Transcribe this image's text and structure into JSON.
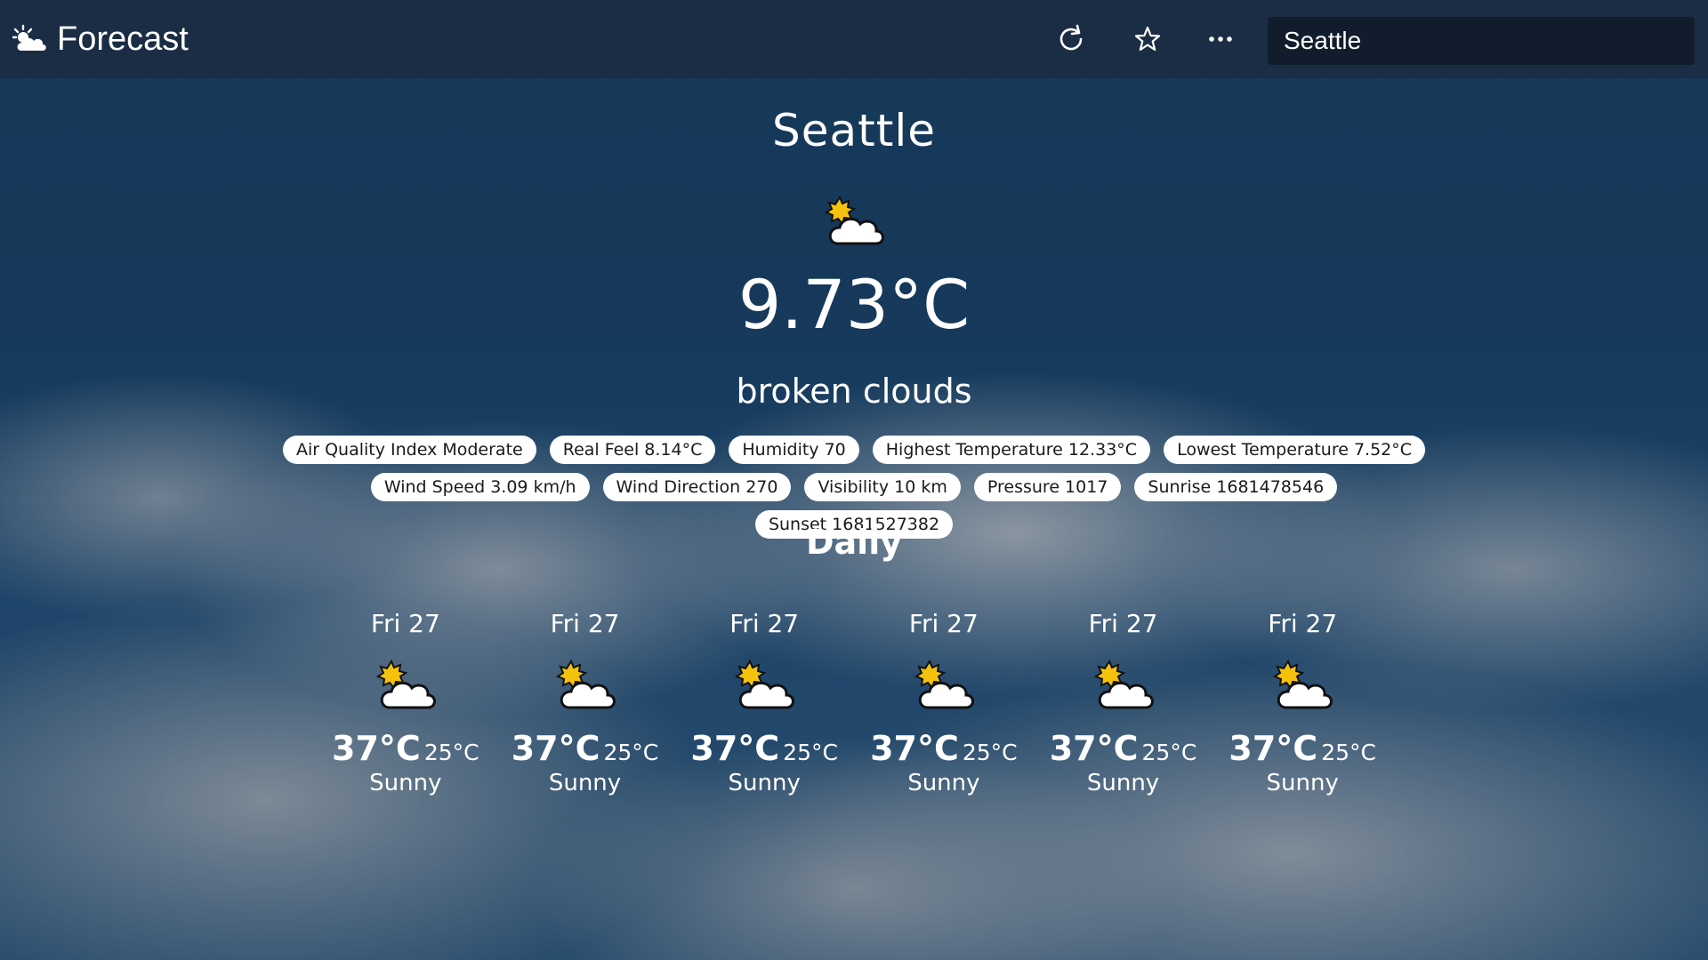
{
  "app": {
    "title": "Forecast",
    "icon": "sun-cloud-icon"
  },
  "toolbar": {
    "refresh_icon": "refresh-icon",
    "favorite_icon": "star-icon",
    "more_icon": "more-icon",
    "search_value": "Seattle"
  },
  "current": {
    "city": "Seattle",
    "icon": "partly-cloudy-icon",
    "temperature": "9.73",
    "unit": "°C",
    "description": "broken clouds",
    "details": [
      "Air Quality Index Moderate",
      "Real Feel 8.14°C",
      "Humidity 70",
      "Highest Temperature 12.33°C",
      "Lowest Temperature 7.52°C",
      "Wind Speed 3.09 km/h",
      "Wind Direction 270",
      "Visibility 10 km",
      "Pressure 1017",
      "Sunrise 1681478546",
      "Sunset 1681527382"
    ]
  },
  "daily": {
    "title": "Daily",
    "days": [
      {
        "date": "Fri 27",
        "icon": "partly-cloudy-icon",
        "high": "37°C",
        "low": "25°C",
        "condition": "Sunny"
      },
      {
        "date": "Fri 27",
        "icon": "partly-cloudy-icon",
        "high": "37°C",
        "low": "25°C",
        "condition": "Sunny"
      },
      {
        "date": "Fri 27",
        "icon": "partly-cloudy-icon",
        "high": "37°C",
        "low": "25°C",
        "condition": "Sunny"
      },
      {
        "date": "Fri 27",
        "icon": "partly-cloudy-icon",
        "high": "37°C",
        "low": "25°C",
        "condition": "Sunny"
      },
      {
        "date": "Fri 27",
        "icon": "partly-cloudy-icon",
        "high": "37°C",
        "low": "25°C",
        "condition": "Sunny"
      },
      {
        "date": "Fri 27",
        "icon": "partly-cloudy-icon",
        "high": "37°C",
        "low": "25°C",
        "condition": "Sunny"
      }
    ]
  },
  "colors": {
    "topbar": "#1b2d44",
    "search_bg": "#111d2c",
    "sun": "#f4c20d",
    "chip_bg": "#ffffff"
  }
}
